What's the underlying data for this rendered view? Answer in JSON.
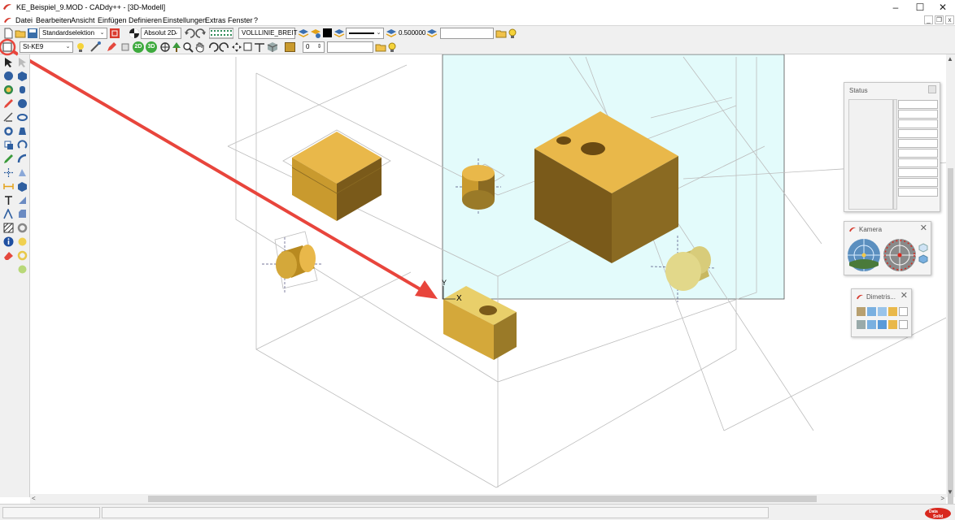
{
  "window": {
    "title": "KE_Beispiel_9.MOD  -  CADdy++ - [3D-Modell]",
    "minimize": "–",
    "maximize": "☐",
    "close": "✕"
  },
  "menu": {
    "items": [
      "Datei",
      "Bearbeiten",
      "Ansicht",
      "Einfügen",
      "Definieren",
      "Einstellungen",
      "Extras",
      "Fenster",
      "?"
    ],
    "mdi_min": "_",
    "mdi_restore": "❐",
    "mdi_close": "x"
  },
  "toolbar1": {
    "selection_mode": "Standardselektion",
    "view_mode": "Absolut 2D",
    "line_type": "VOLLLINIE_BREIT",
    "line_width": "0.500000"
  },
  "toolbar2": {
    "material": "St-KE9",
    "btn_2d": "2D",
    "btn_3d": "3D",
    "layer_value": "0"
  },
  "viewport": {
    "axis_y_label": "Y",
    "axis_x_label": "X",
    "colors": {
      "workplane_fill": "#e3fbfb",
      "part_top": "#e9b84a",
      "part_front": "#c99a2e",
      "part_side": "#7a5a1a",
      "annotation_arrow": "#e8453c"
    }
  },
  "panels": {
    "status": {
      "title": "Status"
    },
    "camera": {
      "title": "Kamera"
    },
    "dimetric": {
      "title": "Dimetris..."
    }
  },
  "scrollbars": {
    "up": "▲",
    "down": "▼",
    "left": "<",
    "right": ">"
  },
  "statusbar": {
    "brand_logo": "Data-Solid-logo"
  }
}
